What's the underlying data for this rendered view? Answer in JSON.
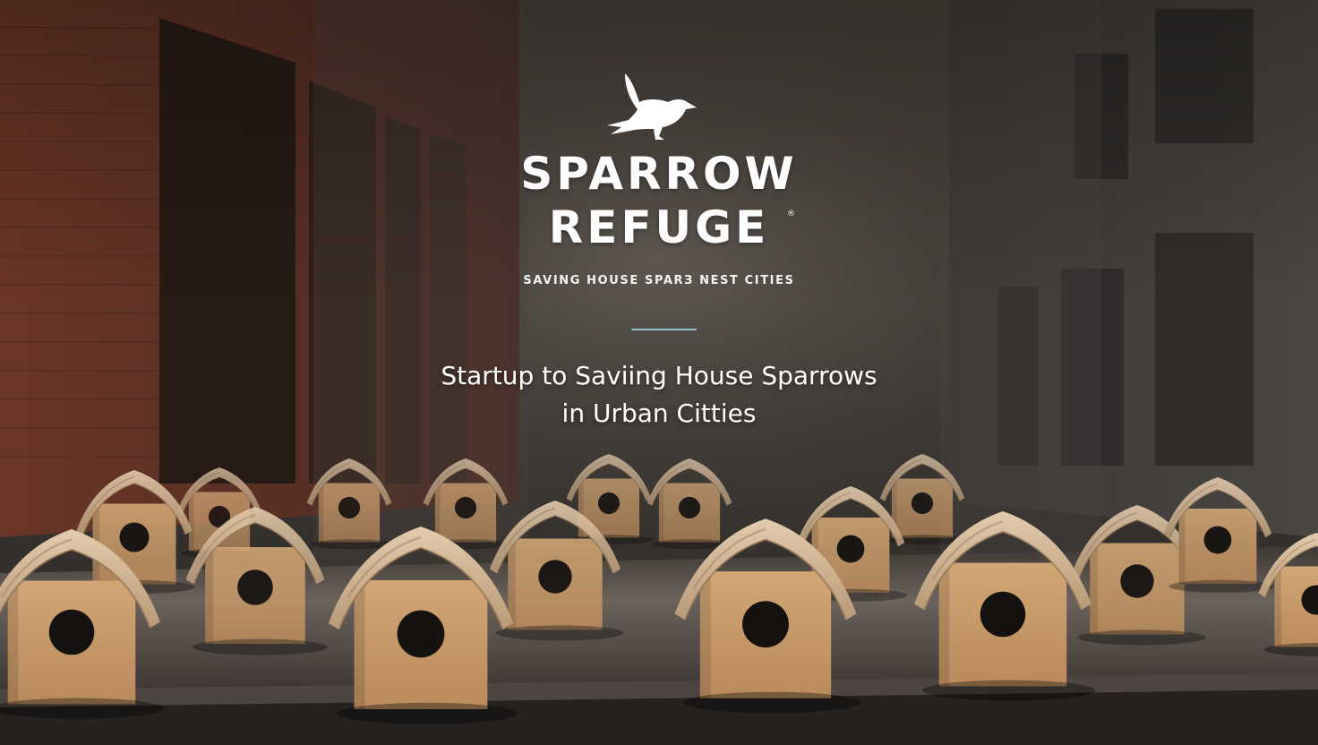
{
  "brand": {
    "name_line1": "SPARROW",
    "name_line2": "REFUGE",
    "registered_mark": "®",
    "tagline": "SAVING HOUSE SPARЗ NEST CITIES",
    "logo_icon": "sparrow-bird-icon"
  },
  "headline": {
    "line1": "Startup to Saviing House Sparrows",
    "line2": "in Urban Citties"
  },
  "colors": {
    "text": "#ffffff",
    "divider_accent": "#8fc3c7",
    "brick_wall": "#6b3a2c",
    "birdhouse_wood": "#c99a6b",
    "ledge": "#5a514b"
  }
}
